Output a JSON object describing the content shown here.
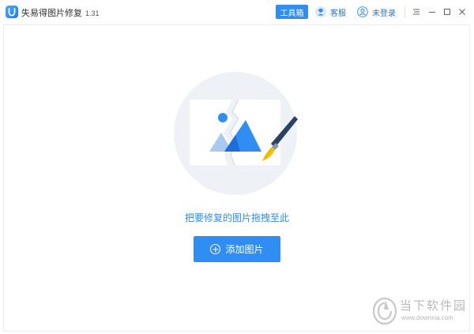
{
  "app": {
    "title": "失易得图片修复",
    "version": "1.31"
  },
  "header": {
    "toolbox_label": "工具箱",
    "service_label": "客服",
    "login_label": "未登录"
  },
  "main": {
    "drop_hint": "把要修复的图片拖拽至此",
    "add_button_label": "添加图片"
  },
  "watermark": {
    "name": "当下软件园",
    "url": "www.downxia.com"
  },
  "icons": {
    "app_logo": "app-logo-icon",
    "service": "headset-user-icon",
    "login": "user-icon",
    "menu": "menu-icon",
    "minimize": "minimize-icon",
    "maximize": "maximize-icon",
    "close": "close-icon",
    "add": "plus-circle-icon"
  },
  "colors": {
    "accent": "#2f8df4",
    "link": "#2c74c8"
  }
}
